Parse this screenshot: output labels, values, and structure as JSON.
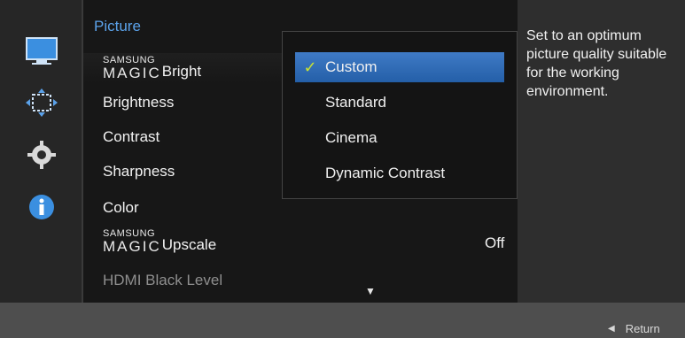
{
  "left_rail": {
    "icons": [
      "monitor-icon",
      "move-icon",
      "gear-icon",
      "info-icon"
    ]
  },
  "menu": {
    "title": "Picture",
    "items": [
      {
        "logo_top": "SAMSUNG",
        "logo_bottom": "MAGIC",
        "label": "Bright"
      },
      {
        "label": "Brightness"
      },
      {
        "label": "Contrast"
      },
      {
        "label": "Sharpness"
      },
      {
        "label": "Color"
      },
      {
        "logo_top": "SAMSUNG",
        "logo_bottom": "MAGIC",
        "label": "Upscale",
        "value": "Off"
      },
      {
        "label": "HDMI Black Level"
      }
    ],
    "scroll_hint": "▼"
  },
  "submenu": {
    "options": [
      "Custom",
      "Standard",
      "Cinema",
      "Dynamic Contrast"
    ],
    "selected_check": "✓"
  },
  "description": {
    "text": "Set to an optimum picture quality suitable for the working environment."
  },
  "footer": {
    "return_label": "Return",
    "return_arrow": "◀"
  },
  "colors": {
    "menu_title": "#5ba2ea",
    "selection": "#3f7ac5",
    "check": "#c9e233"
  }
}
